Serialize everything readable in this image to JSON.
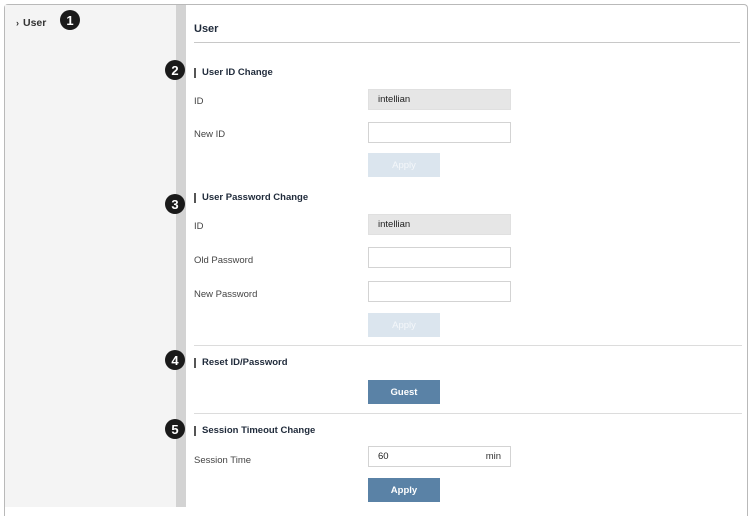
{
  "sidebar": {
    "item_label": "User"
  },
  "badges": [
    "1",
    "2",
    "3",
    "4",
    "5"
  ],
  "panel": {
    "title": "User"
  },
  "user_id_change": {
    "title": "User ID Change",
    "id_label": "ID",
    "id_value": "intellian",
    "new_id_label": "New ID",
    "new_id_value": "",
    "apply_label": "Apply"
  },
  "user_password_change": {
    "title": "User Password Change",
    "id_label": "ID",
    "id_value": "intellian",
    "old_password_label": "Old Password",
    "new_password_label": "New Password",
    "apply_label": "Apply"
  },
  "reset": {
    "title": "Reset ID/Password",
    "guest_label": "Guest"
  },
  "session_timeout": {
    "title": "Session Timeout Change",
    "session_time_label": "Session Time",
    "session_time_value": "60",
    "unit": "min",
    "apply_label": "Apply"
  },
  "colors": {
    "accent": "#5a82a6",
    "disabled_button": "#dbe5ee",
    "readonly_field": "#e6e6e6",
    "sidebar": "#f4f4f4",
    "badge": "#1a1a1a"
  }
}
